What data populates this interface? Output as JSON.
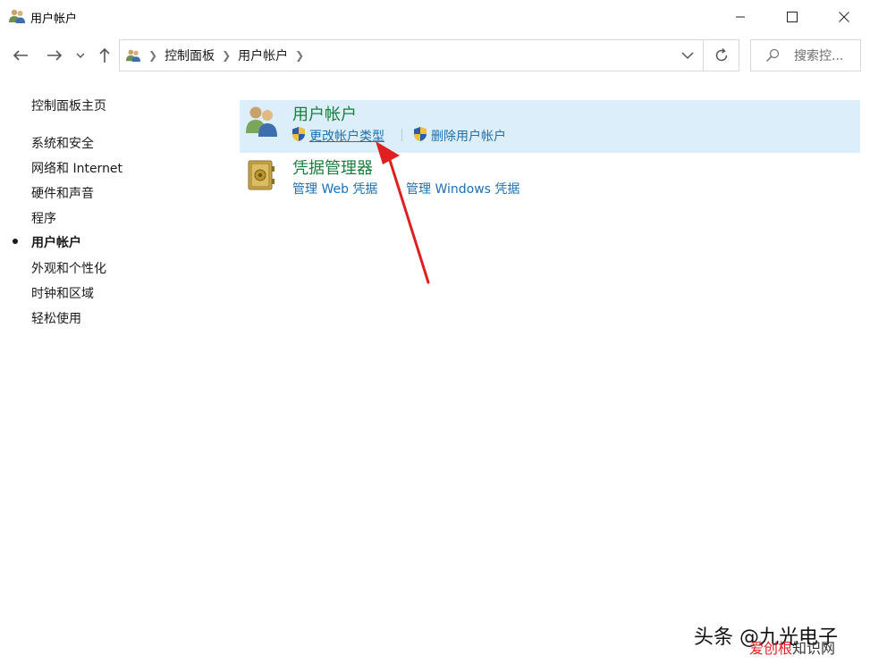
{
  "window": {
    "title": "用户帐户",
    "icon": "users-icon"
  },
  "address_bar": {
    "breadcrumbs": [
      "控制面板",
      "用户帐户"
    ],
    "search_placeholder": "搜索控..."
  },
  "sidebar": {
    "home": "控制面板主页",
    "items": [
      {
        "label": "系统和安全",
        "active": false
      },
      {
        "label": "网络和 Internet",
        "active": false
      },
      {
        "label": "硬件和声音",
        "active": false
      },
      {
        "label": "程序",
        "active": false
      },
      {
        "label": "用户帐户",
        "active": true
      },
      {
        "label": "外观和个性化",
        "active": false
      },
      {
        "label": "时钟和区域",
        "active": false
      },
      {
        "label": "轻松使用",
        "active": false
      }
    ]
  },
  "categories": [
    {
      "title": "用户帐户",
      "icon": "users-icon",
      "highlighted": true,
      "links": [
        "更改帐户类型",
        "删除用户帐户"
      ]
    },
    {
      "title": "凭据管理器",
      "icon": "vault-icon",
      "highlighted": false,
      "links": [
        "管理 Web 凭据",
        "管理 Windows 凭据"
      ]
    }
  ],
  "watermark": {
    "line1": "头条 @九光电子",
    "line2_red": "爱创根",
    "line2_rest": "知识网"
  },
  "colors": {
    "category_title": "#1a7f3c",
    "link": "#1e6fb0",
    "highlight": "#dbeefa",
    "arrow": "#e02020"
  }
}
